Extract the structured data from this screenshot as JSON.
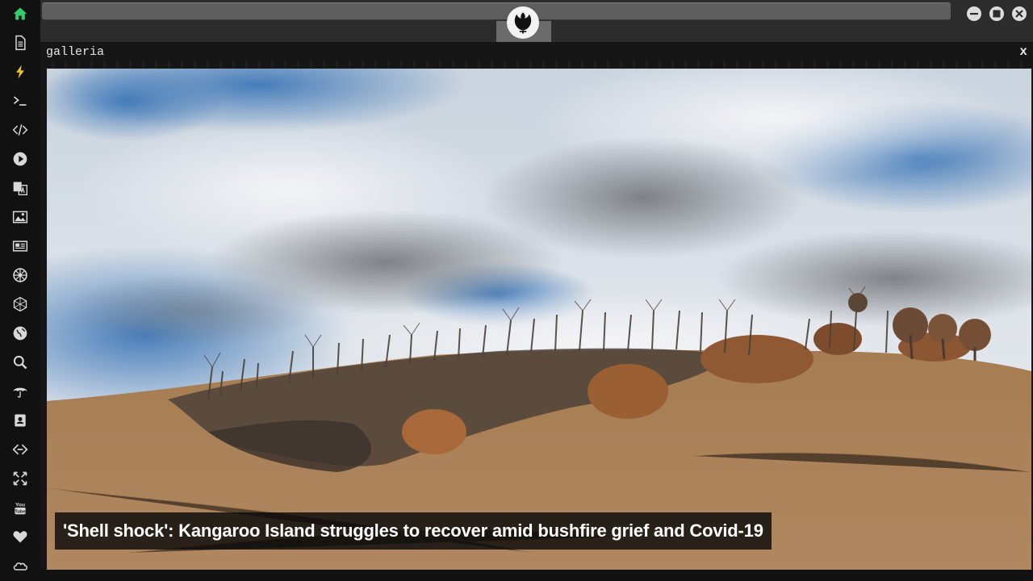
{
  "sidebar": {
    "items": [
      {
        "icon": "home-icon",
        "active": true
      },
      {
        "icon": "document-icon"
      },
      {
        "icon": "lightning-icon"
      },
      {
        "icon": "terminal-icon"
      },
      {
        "icon": "code-icon"
      },
      {
        "icon": "play-icon"
      },
      {
        "icon": "translate-icon"
      },
      {
        "icon": "image-icon"
      },
      {
        "icon": "newspaper-icon"
      },
      {
        "icon": "empire-icon"
      },
      {
        "icon": "hexagon-icon"
      },
      {
        "icon": "globe-icon"
      },
      {
        "icon": "search-icon"
      },
      {
        "icon": "umbrella-icon"
      },
      {
        "icon": "contact-icon"
      },
      {
        "icon": "link-icon"
      },
      {
        "icon": "expand-icon"
      },
      {
        "icon": "youtube-icon"
      },
      {
        "icon": "heart-icon"
      },
      {
        "icon": "cloud-icon"
      }
    ]
  },
  "topbar": {
    "emblem_icon": "rebel-alliance-icon",
    "window_buttons": [
      "minimize-icon",
      "maximize-icon",
      "close-icon"
    ]
  },
  "panel": {
    "title": "galleria",
    "close_label": "x",
    "caption": "'Shell shock': Kangaroo Island struggles to recover amid bushfire grief and Covid-19"
  },
  "colors": {
    "accent_active": "#33cc66",
    "icon_default": "#d8d8d8",
    "panel_bg": "#161616",
    "caption_bg": "#0a0a0a"
  }
}
